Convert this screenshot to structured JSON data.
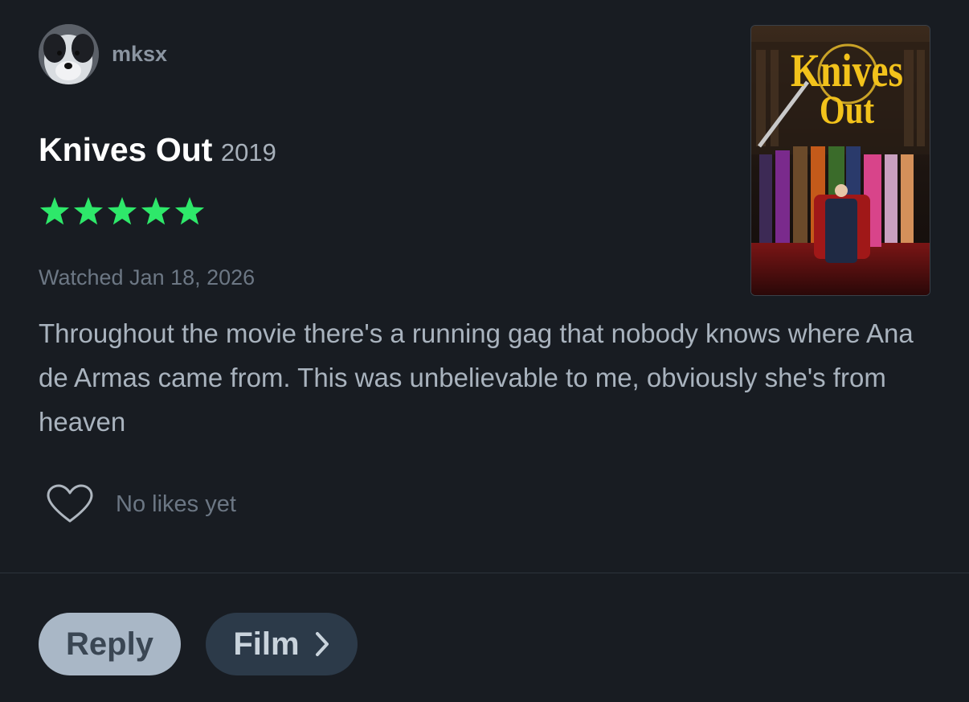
{
  "user": {
    "name": "mksx"
  },
  "film": {
    "title": "Knives Out",
    "year": "2019"
  },
  "rating": {
    "stars": 5,
    "max": 5
  },
  "watched": "Watched Jan 18, 2026",
  "review": "Throughout the movie there's a running gag that nobody knows where Ana de Armas came from. This was unbelievable to me, obviously she's from heaven",
  "poster": {
    "line1": "Knives",
    "line2": "Out"
  },
  "likes": {
    "text": "No likes yet"
  },
  "actions": {
    "reply_label": "Reply",
    "film_label": "Film"
  },
  "colors": {
    "star": "#2ee86a",
    "background": "#181c22"
  }
}
